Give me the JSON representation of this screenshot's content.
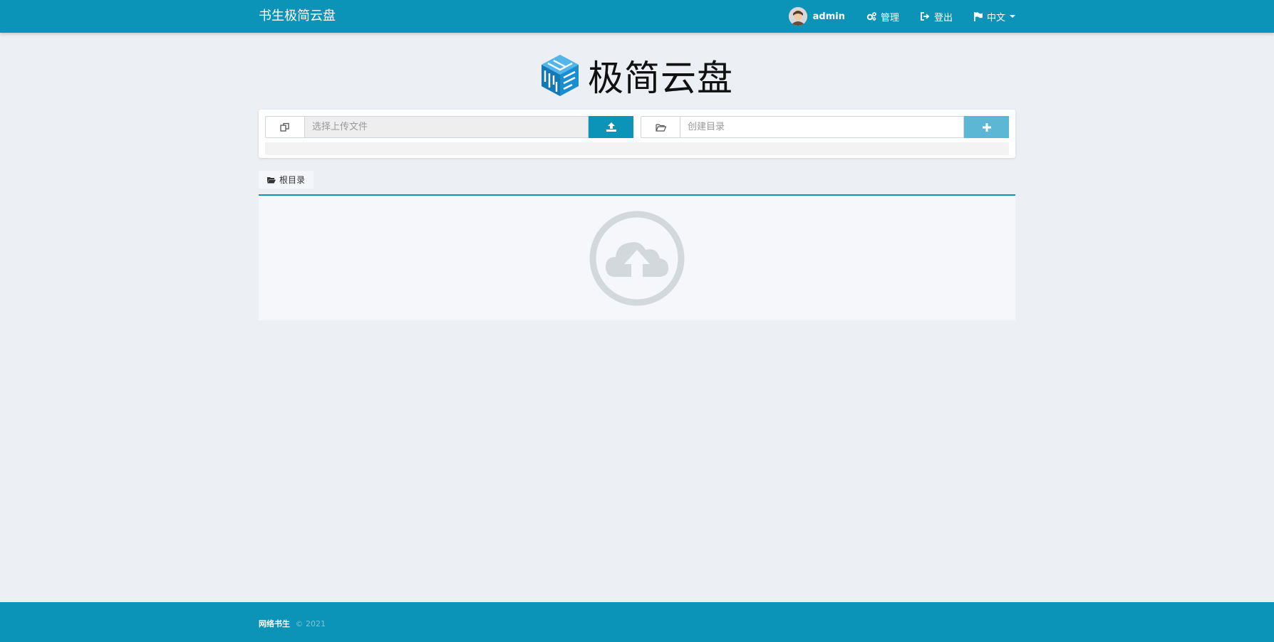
{
  "navbar": {
    "brand": "书生极简云盘",
    "user": "admin",
    "manage": "管理",
    "logout": "登出",
    "language": "中文"
  },
  "logo": {
    "text": "极简云盘"
  },
  "upload": {
    "file_placeholder": "选择上传文件",
    "dir_placeholder": "创建目录"
  },
  "tabs": {
    "root": "根目录"
  },
  "footer": {
    "name": "网络书生",
    "copyright": "© 2021"
  },
  "colors": {
    "primary": "#0b93b8",
    "light_button": "#5bb7d3",
    "background": "#eceff4"
  }
}
